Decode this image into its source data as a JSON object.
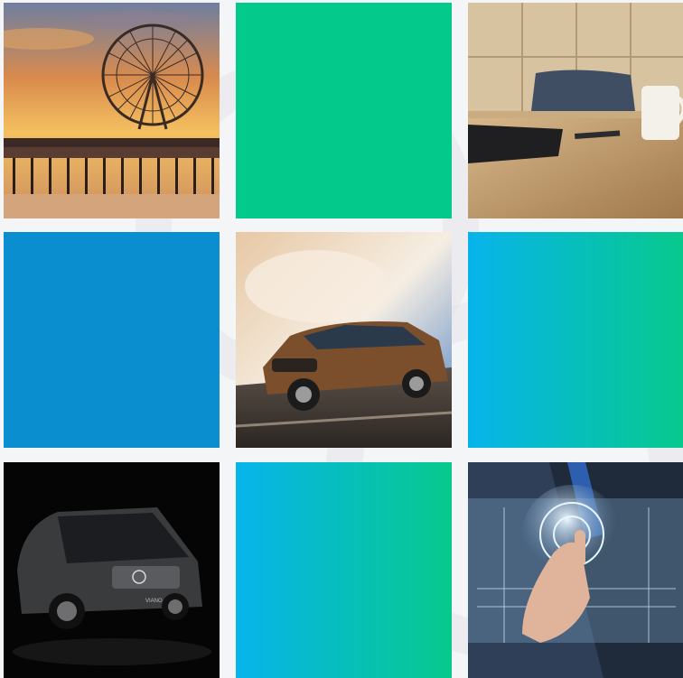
{
  "tiles": [
    {
      "kind": "photo",
      "subject": "ferris-wheel-pier-sunset"
    },
    {
      "kind": "color",
      "color": "#03c98b"
    },
    {
      "kind": "photo",
      "subject": "office-desk-chair-mug"
    },
    {
      "kind": "color",
      "color": "#0a8ed0"
    },
    {
      "kind": "photo",
      "subject": "brown-suv-driving"
    },
    {
      "kind": "gradient",
      "from": "#07b4eb",
      "to": "#07c98c"
    },
    {
      "kind": "photo",
      "subject": "black-minivan-dark-studio"
    },
    {
      "kind": "gradient",
      "from": "#07b4eb",
      "to": "#07c98c"
    },
    {
      "kind": "photo",
      "subject": "businessman-touch-interface"
    }
  ],
  "car_badge_text": "VIANO"
}
